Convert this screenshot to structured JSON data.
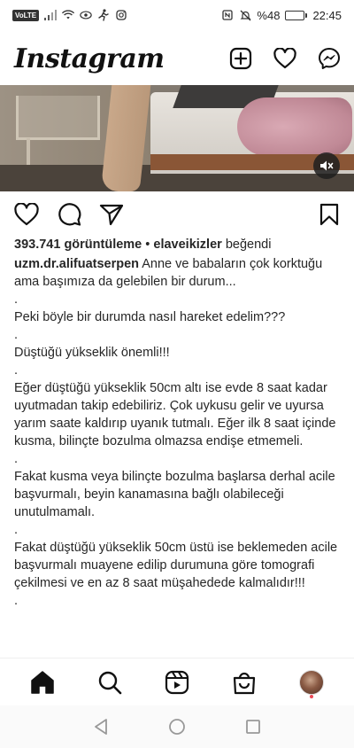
{
  "status_bar": {
    "volte_label": "VoLTE",
    "battery_text": "%48",
    "battery_level": 0.48,
    "time": "22:45"
  },
  "header": {
    "logo_text": "Instagram",
    "icons": [
      "new-post-icon",
      "heart-icon",
      "messenger-icon"
    ]
  },
  "post": {
    "views_count": "393.741 görüntüleme",
    "views_separator": " • ",
    "liked_by_user": "elaveikizler",
    "liked_suffix": " beğendi",
    "author": "uzm.dr.alifuatserpen",
    "caption_first": "Anne ve babaların çok korktuğu ama başımıza da gelebilen bir durum...",
    "caption_lines": [
      ".",
      "Peki böyle bir durumda nasıl hareket edelim???",
      ".",
      "Düştüğü yükseklik önemli!!!",
      ".",
      "Eğer düştüğü yükseklik 50cm altı ise evde 8 saat kadar uyutmadan takip edebiliriz. Çok uykusu gelir ve uyursa yarım saate kaldırıp uyanık tutmalı. Eğer ilk 8 saat içinde kusma, bilinçte bozulma olmazsa endişe etmemeli.",
      ".",
      "Fakat kusma veya bilinçte bozulma başlarsa derhal acile başvurmalı, beyin kanamasına bağlı olabileceği unutulmamalı.",
      ".",
      "Fakat düştüğü yükseklik 50cm üstü ise beklemeden acile başvurmalı muayene edilip durumuna göre tomografi çekilmesi ve en az 8 saat müşahedede kalmalıdır!!!",
      "."
    ]
  },
  "accent_colors": {
    "notification_dot": "#ed4956",
    "text": "#262626"
  }
}
